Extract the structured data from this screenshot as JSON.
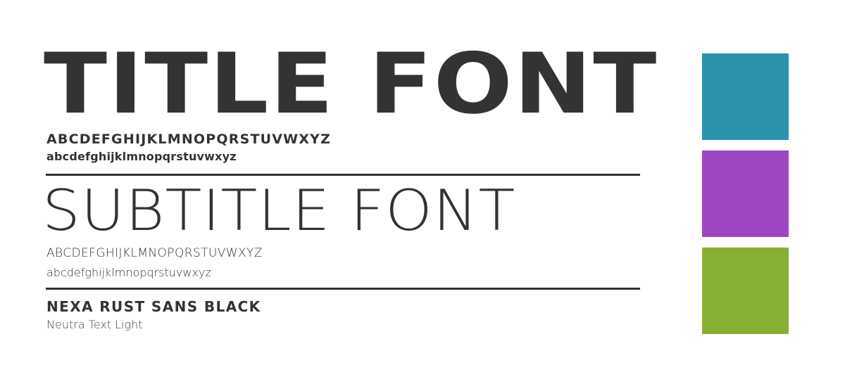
{
  "title": {
    "sample": "TITLE FONT",
    "uppercase": "ABCDEFGHIJKLMNOPQRSTUVWXYZ",
    "lowercase": "abcdefghijklmnopqrstuvwxyz"
  },
  "subtitle": {
    "sample": "SUBTITLE FONT",
    "uppercase": "ABCDEFGHIJKLMNOPQRSTUVWXYZ",
    "lowercase": "abcdefghijklmnopqrstuvwxyz"
  },
  "font_names": {
    "title_font": "NEXA RUST SANS BLACK",
    "subtitle_font": "Neutra Text Light"
  },
  "palette": [
    {
      "name": "teal",
      "color": "#2A93AB"
    },
    {
      "name": "purple",
      "color": "#9D46C2"
    },
    {
      "name": "green",
      "color": "#87AF33"
    }
  ],
  "text_color": "#333333"
}
